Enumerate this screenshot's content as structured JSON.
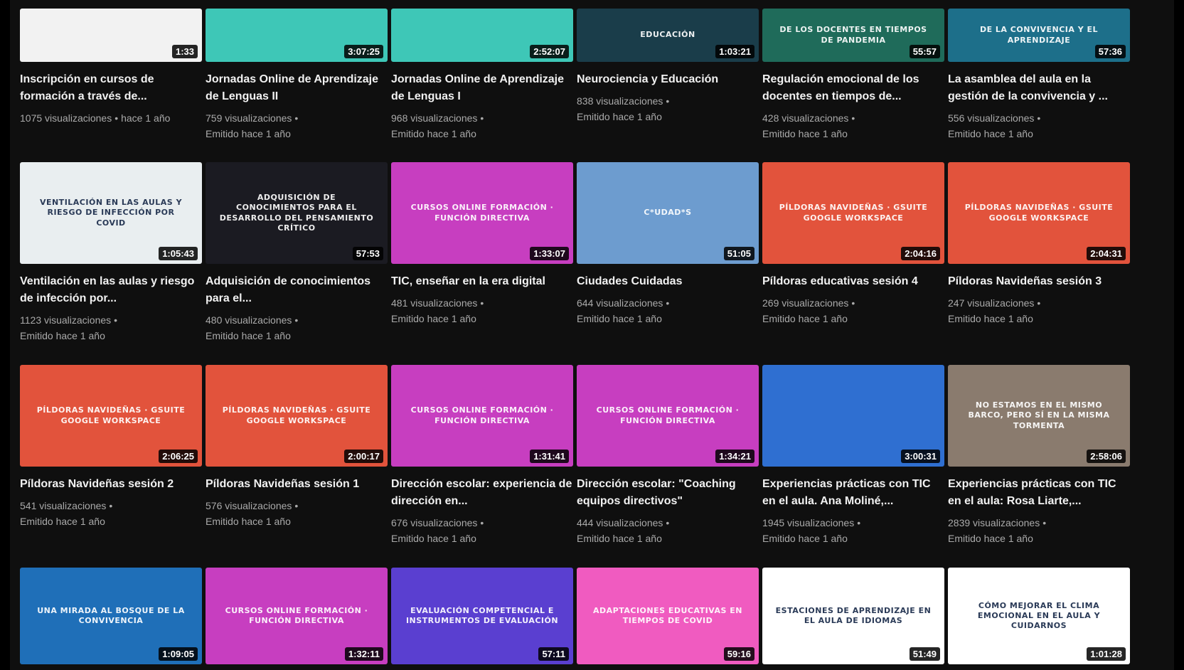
{
  "rows": [
    [
      {
        "duration": "1:33",
        "title": "Inscripción en cursos de formación a través de...",
        "views": "1075 visualizaciones",
        "age": "hace 1 año",
        "thumb_color": "#f2f2f2",
        "thumb_text": ""
      },
      {
        "duration": "3:07:25",
        "title": "Jornadas Online de Aprendizaje de Lenguas II",
        "views": "759 visualizaciones",
        "age": "Emitido hace 1 año",
        "thumb_color": "#3ec7b7",
        "thumb_text": ""
      },
      {
        "duration": "2:52:07",
        "title": "Jornadas Online de Aprendizaje de Lenguas I",
        "views": "968 visualizaciones",
        "age": "Emitido hace 1 año",
        "thumb_color": "#3ec7b7",
        "thumb_text": ""
      },
      {
        "duration": "1:03:21",
        "title": "Neurociencia y Educación",
        "views": "838 visualizaciones",
        "age": "Emitido hace 1 año",
        "thumb_color": "#1a3d4a",
        "thumb_text": "EDUCACIÓN"
      },
      {
        "duration": "55:57",
        "title": "Regulación emocional de los docentes en tiempos de...",
        "views": "428 visualizaciones",
        "age": "Emitido hace 1 año",
        "thumb_color": "#1f6b5a",
        "thumb_text": "DE LOS DOCENTES EN TIEMPOS DE PANDEMIA"
      },
      {
        "duration": "57:36",
        "title": "La asamblea del aula en la gestión de la convivencia y ...",
        "views": "556 visualizaciones",
        "age": "Emitido hace 1 año",
        "thumb_color": "#1d6f8a",
        "thumb_text": "DE LA CONVIVENCIA Y EL APRENDIZAJE"
      }
    ],
    [
      {
        "duration": "1:05:43",
        "title": "Ventilación en las aulas y riesgo de infección por...",
        "views": "1123 visualizaciones",
        "age": "Emitido hace 1 año",
        "thumb_color": "#e9eef0",
        "thumb_text": "VENTILACIÓN EN LAS AULAS Y RIESGO DE INFECCIÓN POR COVID"
      },
      {
        "duration": "57:53",
        "title": "Adquisición de conocimientos para el...",
        "views": "480 visualizaciones",
        "age": "Emitido hace 1 año",
        "thumb_color": "#1b1b22",
        "thumb_text": "ADQUISICIÓN DE CONOCIMIENTOS PARA EL DESARROLLO DEL PENSAMIENTO CRÍTICO"
      },
      {
        "duration": "1:33:07",
        "title": "TIC, enseñar en la era digital",
        "views": "481 visualizaciones",
        "age": "Emitido hace 1 año",
        "thumb_color": "#c73ec0",
        "thumb_text": "CURSOS ONLINE FORMACIÓN · FUNCIÓN DIRECTIVA"
      },
      {
        "duration": "51:05",
        "title": "Ciudades Cuidadas",
        "views": "644 visualizaciones",
        "age": "Emitido hace 1 año",
        "thumb_color": "#6d9ccf",
        "thumb_text": "C*UDAD*S"
      },
      {
        "duration": "2:04:16",
        "title": "Píldoras educativas sesión 4",
        "views": "269 visualizaciones",
        "age": "Emitido hace 1 año",
        "thumb_color": "#e2533c",
        "thumb_text": "PÍLDORAS NAVIDEÑAS · GSUITE GOOGLE WORKSPACE"
      },
      {
        "duration": "2:04:31",
        "title": "Píldoras Navideñas sesión 3",
        "views": "247 visualizaciones",
        "age": "Emitido hace 1 año",
        "thumb_color": "#e2533c",
        "thumb_text": "PÍLDORAS NAVIDEÑAS · GSUITE GOOGLE WORKSPACE"
      }
    ],
    [
      {
        "duration": "2:06:25",
        "title": "Píldoras Navideñas sesión 2",
        "views": "541 visualizaciones",
        "age": "Emitido hace 1 año",
        "thumb_color": "#e2533c",
        "thumb_text": "PÍLDORAS NAVIDEÑAS · GSUITE GOOGLE WORKSPACE"
      },
      {
        "duration": "2:00:17",
        "title": "Píldoras Navideñas sesión 1",
        "views": "576 visualizaciones",
        "age": "Emitido hace 1 año",
        "thumb_color": "#e2533c",
        "thumb_text": "PÍLDORAS NAVIDEÑAS · GSUITE GOOGLE WORKSPACE"
      },
      {
        "duration": "1:31:41",
        "title": "Dirección escolar: experiencia de dirección en...",
        "views": "676 visualizaciones",
        "age": "Emitido hace 1 año",
        "thumb_color": "#c73ec0",
        "thumb_text": "CURSOS ONLINE FORMACIÓN · FUNCIÓN DIRECTIVA"
      },
      {
        "duration": "1:34:21",
        "title": "Dirección escolar: \"Coaching equipos directivos\"",
        "views": "444 visualizaciones",
        "age": "Emitido hace 1 año",
        "thumb_color": "#c73ec0",
        "thumb_text": "CURSOS ONLINE FORMACIÓN · FUNCIÓN DIRECTIVA"
      },
      {
        "duration": "3:00:31",
        "title": "Experiencias prácticas con TIC en el aula. Ana Moliné,...",
        "views": "1945 visualizaciones",
        "age": "Emitido hace 1 año",
        "thumb_color": "#2f6fd1",
        "thumb_text": ""
      },
      {
        "duration": "2:58:06",
        "title": "Experiencias prácticas con TIC en el aula: Rosa Liarte,...",
        "views": "2839 visualizaciones",
        "age": "Emitido hace 1 año",
        "thumb_color": "#8a7b6e",
        "thumb_text": "NO ESTAMOS EN EL MISMO BARCO, PERO SÍ EN LA MISMA TORMENTA"
      }
    ],
    [
      {
        "duration": "1:09:05",
        "title": "",
        "views": "",
        "age": "",
        "thumb_color": "#1f6fb8",
        "thumb_text": "Una mirada al bosque de la convivencia"
      },
      {
        "duration": "1:32:11",
        "title": "",
        "views": "",
        "age": "",
        "thumb_color": "#c73ec0",
        "thumb_text": "CURSOS ONLINE FORMACIÓN · FUNCIÓN DIRECTIVA"
      },
      {
        "duration": "57:11",
        "title": "",
        "views": "",
        "age": "",
        "thumb_color": "#5a3fd0",
        "thumb_text": "Evaluación competencial e instrumentos de evaluación"
      },
      {
        "duration": "59:16",
        "title": "",
        "views": "",
        "age": "",
        "thumb_color": "#f05bc0",
        "thumb_text": "ADAPTACIONES EDUCATIVAS EN TIEMPOS DE COVID"
      },
      {
        "duration": "51:49",
        "title": "",
        "views": "",
        "age": "",
        "thumb_color": "#ffffff",
        "thumb_text": "ESTACIONES DE APRENDIZAJE EN EL AULA DE IDIOMAS"
      },
      {
        "duration": "1:01:28",
        "title": "",
        "views": "",
        "age": "",
        "thumb_color": "#ffffff",
        "thumb_text": "CÓMO MEJORAR EL CLIMA EMOCIONAL EN EL AULA Y CUIDARNOS"
      }
    ]
  ],
  "separator": "•"
}
